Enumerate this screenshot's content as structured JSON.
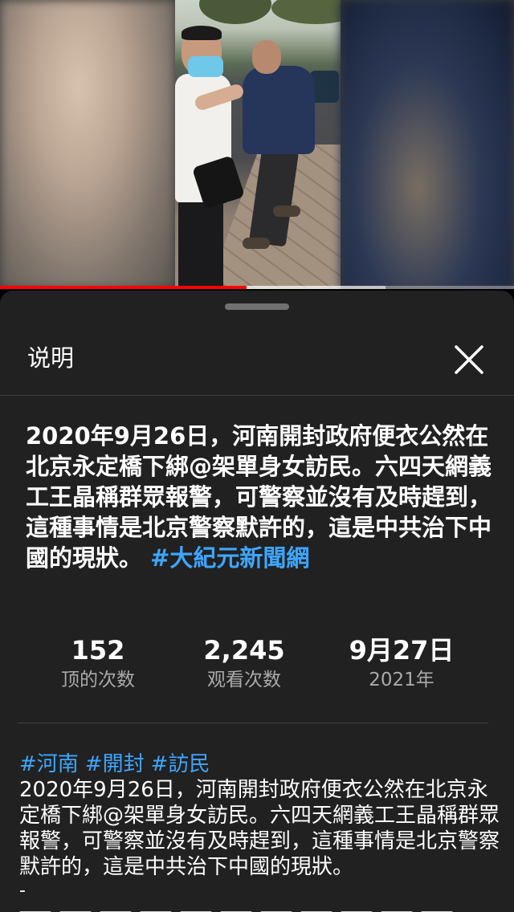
{
  "video": {
    "progress_percent": 48,
    "buffered_percent": 75
  },
  "sheet": {
    "title": "说明",
    "headline_text": "2020年9月26日，河南開封政府便衣公然在北京永定橋下綁@架單身女訪民。六四天網義工王晶稱群眾報警，可警察並沒有及時趕到，這種事情是北京警察默許的，這是中共治下中國的現狀。",
    "headline_tag": "#大紀元新聞網"
  },
  "stats": {
    "likes": {
      "value": "152",
      "label": "顶的次数"
    },
    "views": {
      "value": "2,245",
      "label": "观看次数"
    },
    "date": {
      "value": "9月27日",
      "label": "2021年"
    }
  },
  "description": {
    "hashtags": [
      "#河南",
      "#開封",
      "#訪民"
    ],
    "body": "2020年9月26日，河南開封政府便衣公然在北京永定橋下綁@架單身女訪民。六四天網義工王晶稱群眾報警，可警察並沒有及時趕到，這種事情是北京警察默許的，這是中共治下中國的現狀。",
    "separator": "-"
  },
  "colors": {
    "accent_link": "#3ea6ff",
    "progress": "#ff0000",
    "sheet_bg": "#212121"
  },
  "icons": {
    "close": "close-icon"
  }
}
